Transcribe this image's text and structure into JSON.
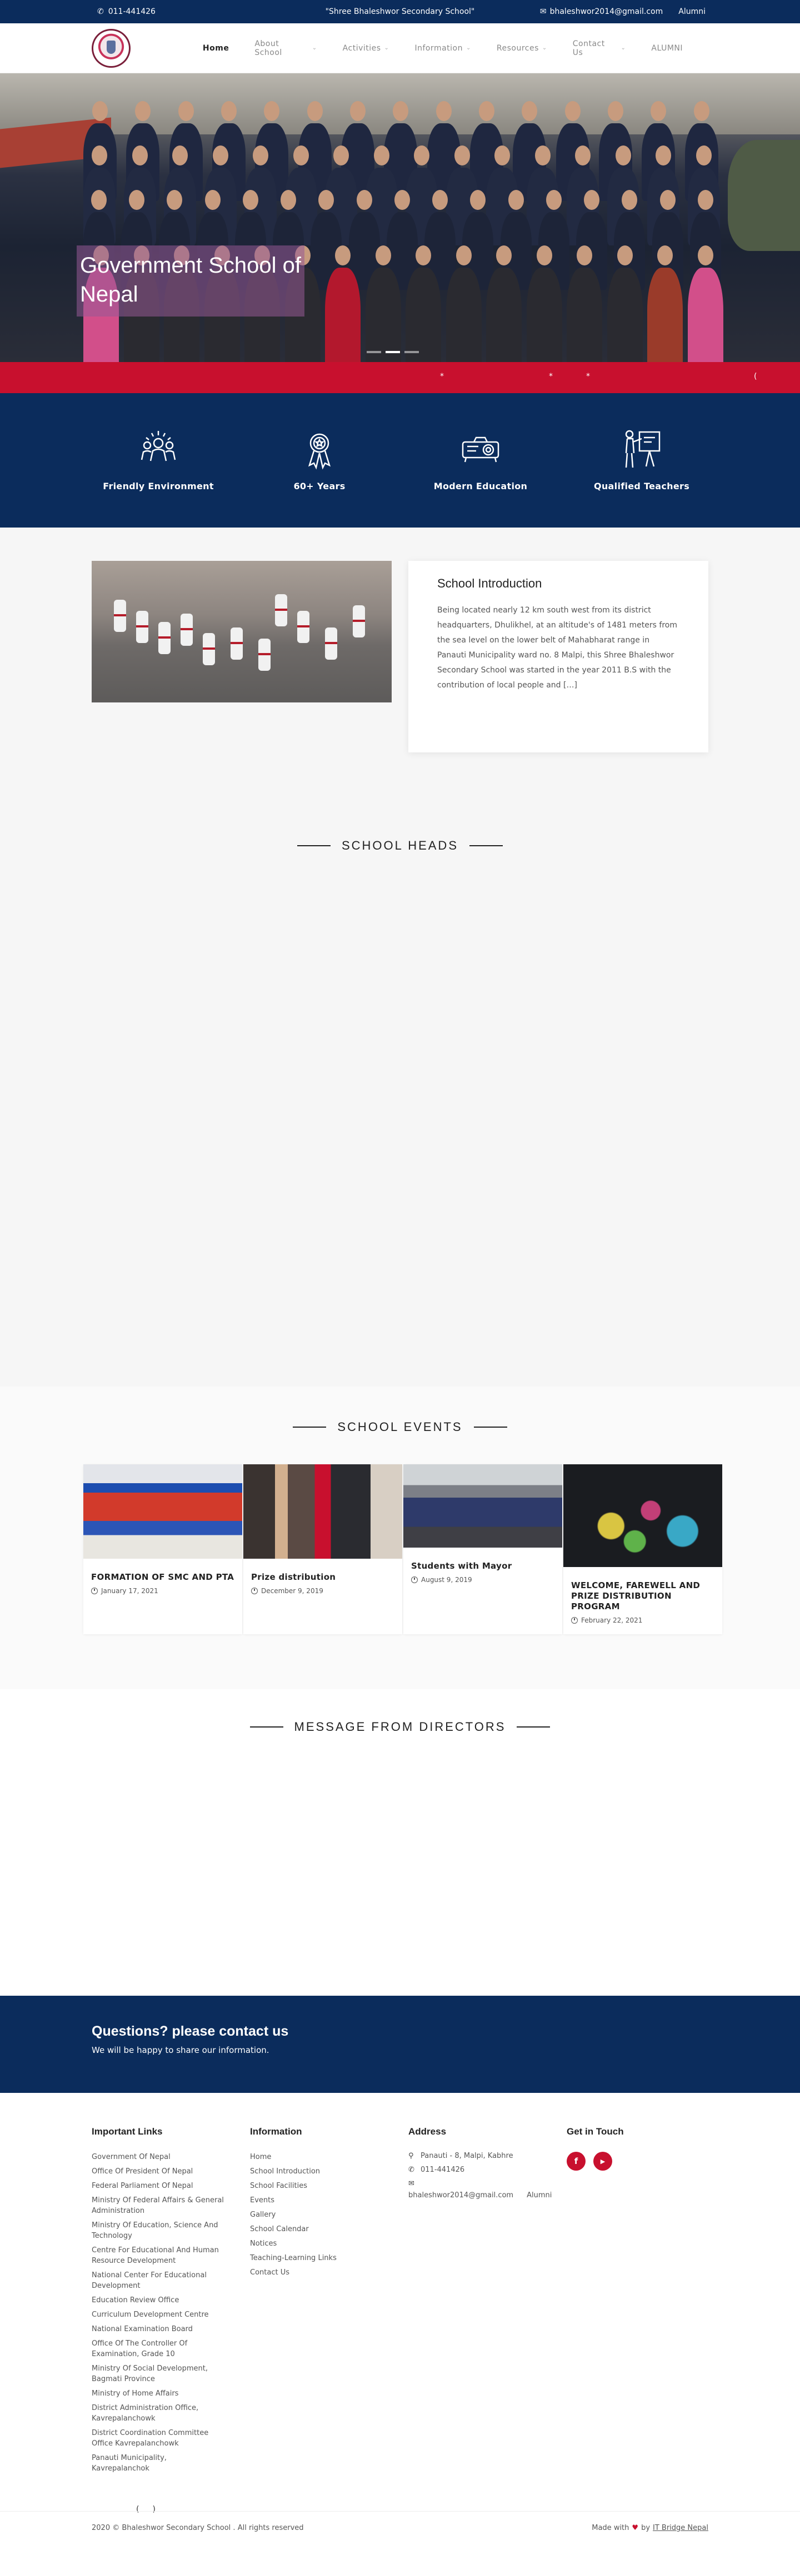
{
  "topbar": {
    "phone": "011-441426",
    "tagline": "\"Shree Bhaleshwor Secondary School\"",
    "email": "bhaleshwor2014@gmail.com",
    "alumni": "Alumni"
  },
  "nav": [
    {
      "label": "Home",
      "dropdown": false
    },
    {
      "label": "About School",
      "dropdown": true
    },
    {
      "label": "Activities",
      "dropdown": true
    },
    {
      "label": "Information",
      "dropdown": true
    },
    {
      "label": "Resources",
      "dropdown": true
    },
    {
      "label": "Contact Us",
      "dropdown": true
    },
    {
      "label": "ALUMNI",
      "dropdown": false
    }
  ],
  "hero": {
    "caption": "Government School of Nepal",
    "slide_total": 3,
    "slide_active": 1
  },
  "ticker": {
    "items": [
      "*",
      "*",
      "*",
      "("
    ]
  },
  "features": [
    {
      "icon": "community-icon",
      "label": "Friendly Environment"
    },
    {
      "icon": "award-ribbon-icon",
      "label": "60+ Years"
    },
    {
      "icon": "projector-icon",
      "label": "Modern Education"
    },
    {
      "icon": "teacher-board-icon",
      "label": "Qualified Teachers"
    }
  ],
  "intro": {
    "title": "School Introduction",
    "text": "Being located nearly 12 km south west from its district headquarters, Dhulikhel, at an altitude's of 1481 meters from the sea level on the lower belt of Mahabharat range in Panauti Municipality ward no. 8 Malpi, this Shree Bhaleshwor Secondary School was started in the year 2011 B.S with the contribution of local people and […]"
  },
  "sections": {
    "heads": "SCHOOL HEADS",
    "events": "SCHOOL EVENTS",
    "directors": "MESSAGE FROM DIRECTORS"
  },
  "events": [
    {
      "title": "FORMATION OF SMC AND PTA",
      "date": "January 17, 2021"
    },
    {
      "title": "Prize distribution",
      "date": "December 9, 2019"
    },
    {
      "title": "Students with Mayor",
      "date": "August 9, 2019"
    },
    {
      "title": "WELCOME, FAREWELL AND PRIZE DISTRIBUTION PROGRAM",
      "date": "February 22, 2021"
    }
  ],
  "cta": {
    "title": "Questions? please contact us",
    "subtitle": "We will be happy to share our information."
  },
  "footer": {
    "links_title": "Important Links",
    "links": [
      "Government Of Nepal",
      "Office Of President Of Nepal",
      "Federal Parliament Of Nepal",
      "Ministry Of Federal Affairs & General Administration",
      "Ministry Of Education, Science And Technology",
      "Centre For Educational And Human Resource Development",
      "National Center For Educational Development",
      "Education Review Office",
      "Curriculum Development Centre",
      "National Examination Board",
      "Office Of The Controller Of Examination, Grade 10",
      "Ministry Of Social Development, Bagmati Province",
      "Ministry of Home Affairs",
      "District Administration Office, Kavrepalanchowk",
      "District Coordination Committee Office Kavrepalanchowk",
      "Panauti Municipality, Kavrepalanchok"
    ],
    "pager": [
      "(",
      ")"
    ],
    "info_title": "Information",
    "info": [
      "Home",
      "School Introduction",
      "School Facilities",
      "Events",
      "Gallery",
      "School Calendar",
      "Notices",
      "Teaching-Learning Links",
      "Contact Us"
    ],
    "address_title": "Address",
    "address": "Panauti - 8, Malpi, Kabhre",
    "phone": "011-441426",
    "email": "bhaleshwor2014@gmail.com",
    "alumni": "Alumni",
    "touch_title": "Get in Touch",
    "social": [
      {
        "icon": "facebook-icon",
        "glyph": "f"
      },
      {
        "icon": "youtube-icon",
        "glyph": "▶"
      }
    ],
    "copyright": "2020 © Bhaleshwor Secondary School . All rights reserved",
    "made_with": "Made with",
    "by": "by",
    "developer": "IT Bridge Nepal"
  },
  "colors": {
    "navy": "#0b2c5c",
    "red": "#c8102e",
    "caption_overlay": "#965a96"
  }
}
